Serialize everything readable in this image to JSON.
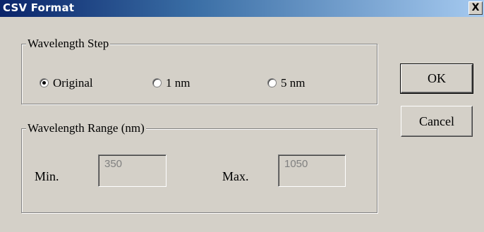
{
  "window": {
    "title": "CSV Format",
    "close_label": "X"
  },
  "wavelength_step": {
    "label": "Wavelength Step",
    "options": [
      {
        "label": "Original",
        "selected": true
      },
      {
        "label": "1 nm",
        "selected": false
      },
      {
        "label": "5 nm",
        "selected": false
      }
    ]
  },
  "wavelength_range": {
    "label": "Wavelength Range (nm)",
    "min_label": "Min.",
    "min_value": "350",
    "max_label": "Max.",
    "max_value": "1050"
  },
  "buttons": {
    "ok": "OK",
    "cancel": "Cancel"
  }
}
